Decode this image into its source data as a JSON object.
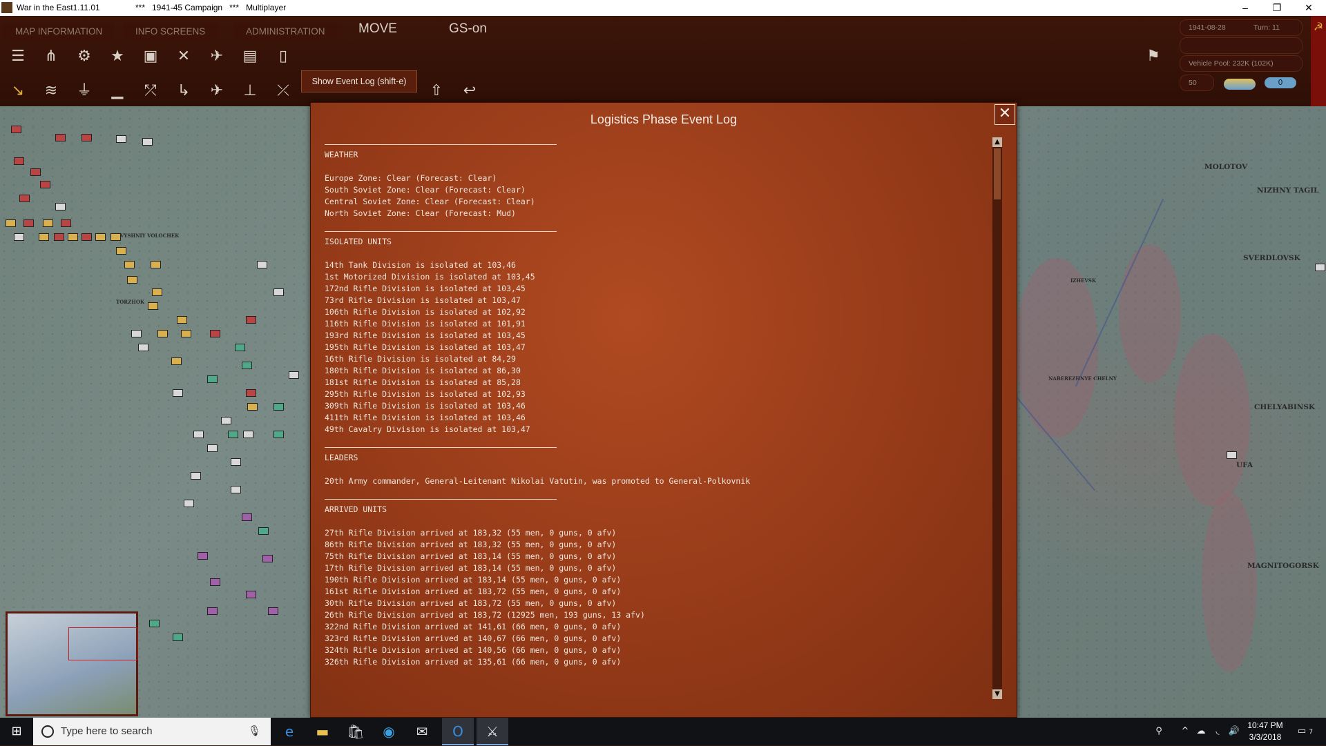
{
  "window": {
    "title": "War in the East1.11.01",
    "subtitle": "***   1941-45 Campaign   ***   Multiplayer",
    "minimize": "–",
    "maximize": "❐",
    "close": "✕"
  },
  "toolbar": {
    "tabs": [
      "MAP INFORMATION",
      "INFO SCREENS",
      "ADMINISTRATION"
    ],
    "mode": "MOVE",
    "gs": "GS-on",
    "tooltip": "Show Event Log (shift-e)",
    "date": "1941-08-28",
    "turn": "Turn: 11",
    "vehicle_pool": "Vehicle Pool: 232K (102K)",
    "slider_value": "50",
    "toggle_value": "0"
  },
  "dialog": {
    "title": "Logistics Phase Event Log",
    "close_label": "✕",
    "sections": [
      {
        "heading": "WEATHER",
        "lines": [
          "Europe Zone: Clear (Forecast: Clear)",
          "South Soviet Zone: Clear (Forecast: Clear)",
          "Central Soviet Zone: Clear (Forecast: Clear)",
          "North Soviet Zone: Clear (Forecast: Mud)"
        ]
      },
      {
        "heading": "ISOLATED UNITS",
        "lines": [
          "14th Tank Division is isolated at 103,46",
          "1st Motorized Division is isolated at 103,45",
          "172nd Rifle Division is isolated at 103,45",
          "73rd Rifle Division is isolated at 103,47",
          "106th Rifle Division is isolated at 102,92",
          "116th Rifle Division is isolated at 101,91",
          "193rd Rifle Division is isolated at 103,45",
          "195th Rifle Division is isolated at 103,47",
          "16th Rifle Division is isolated at 84,29",
          "180th Rifle Division is isolated at 86,30",
          "181st Rifle Division is isolated at 85,28",
          "295th Rifle Division is isolated at 102,93",
          "309th Rifle Division is isolated at 103,46",
          "411th Rifle Division is isolated at 103,46",
          "49th Cavalry Division is isolated at 103,47"
        ]
      },
      {
        "heading": "LEADERS",
        "lines": [
          "20th Army commander, General-Leitenant Nikolai Vatutin, was promoted to General-Polkovnik"
        ]
      },
      {
        "heading": "ARRIVED UNITS",
        "lines": [
          "27th Rifle Division arrived at 183,32 (55 men, 0 guns, 0 afv)",
          "86th Rifle Division arrived at 183,32 (55 men, 0 guns, 0 afv)",
          "75th Rifle Division arrived at 183,14 (55 men, 0 guns, 0 afv)",
          "17th Rifle Division arrived at 183,14 (55 men, 0 guns, 0 afv)",
          "190th Rifle Division arrived at 183,14 (55 men, 0 guns, 0 afv)",
          "161st Rifle Division arrived at 183,72 (55 men, 0 guns, 0 afv)",
          "30th Rifle Division arrived at 183,72 (55 men, 0 guns, 0 afv)",
          "26th Rifle Division arrived at 183,72 (12925 men, 193 guns, 13 afv)",
          "322nd Rifle Division arrived at 141,61 (66 men, 0 guns, 0 afv)",
          "323rd Rifle Division arrived at 140,67 (66 men, 0 guns, 0 afv)",
          "324th Rifle Division arrived at 140,56 (66 men, 0 guns, 0 afv)",
          "326th Rifle Division arrived at 135,61 (66 men, 0 guns, 0 afv)"
        ]
      }
    ]
  },
  "map": {
    "cities": [
      "MOLOTOV",
      "NIZHNY TAGIL",
      "SVERDLOVSK",
      "CHELYABINSK",
      "UFA",
      "MAGNITOGORSK",
      "IZHEVSK",
      "NABEREZHNYE CHELNY",
      "VYSHNIY VOLOCHEK",
      "TORZHOK"
    ]
  },
  "taskbar": {
    "search_placeholder": "Type here to search",
    "time": "10:47 PM",
    "date": "3/3/2018",
    "notifications": "7"
  }
}
